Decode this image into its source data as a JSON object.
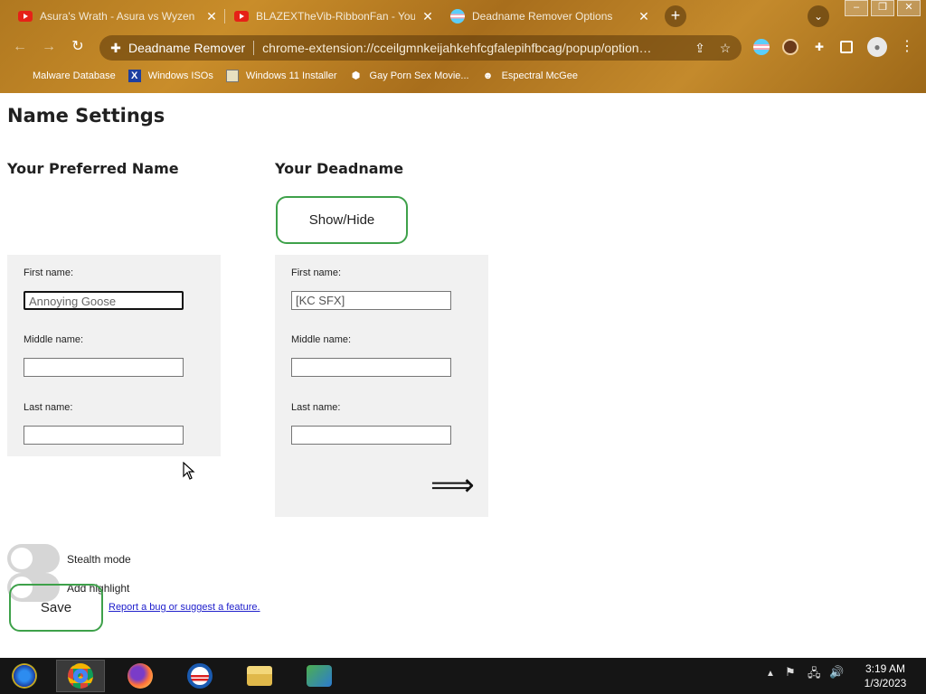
{
  "browser": {
    "tabs": [
      {
        "title": "Asura's Wrath - Asura vs Wyzen",
        "icon": "youtube-icon"
      },
      {
        "title": "BLAZEXTheVib-RibbonFan - YouTube",
        "icon": "youtube-icon"
      },
      {
        "title": "Deadname Remover Options",
        "icon": "trans-flag-icon"
      }
    ],
    "close_glyph": "✕",
    "new_tab_glyph": "+",
    "omnibox": {
      "site_name": "Deadname Remover",
      "url": "chrome-extension://cceilgmnkeijahkehfcgfalepihfbcag/popup/option…"
    },
    "bookmarks": [
      {
        "label": "Malware Database"
      },
      {
        "label": "Windows ISOs"
      },
      {
        "label": "Windows 11 Installer"
      },
      {
        "label": "Gay Porn Sex Movie..."
      },
      {
        "label": "Espectral McGee"
      }
    ]
  },
  "page": {
    "title": "Name Settings",
    "preferred": {
      "heading": "Your Preferred Name",
      "first_label": "First name:",
      "first_value": "Annoying Goose",
      "middle_label": "Middle name:",
      "middle_value": "",
      "last_label": "Last name:",
      "last_value": ""
    },
    "deadname": {
      "heading": "Your Deadname",
      "show_hide": "Show/Hide",
      "first_label": "First name:",
      "first_value": "[KC SFX]",
      "middle_label": "Middle name:",
      "middle_value": "",
      "last_label": "Last name:",
      "last_value": "",
      "arrow": "⟹"
    },
    "stealth_label": "Stealth mode",
    "stealth_on": false,
    "highlight_label": "Add highlight",
    "highlight_on": false,
    "save_label": "Save",
    "report_link": "Report a bug or suggest a feature."
  },
  "taskbar": {
    "time": "3:19 AM",
    "date": "1/3/2023"
  },
  "colors": {
    "accent_green": "#3ea14a",
    "panel_bg": "#f1f1f1"
  }
}
